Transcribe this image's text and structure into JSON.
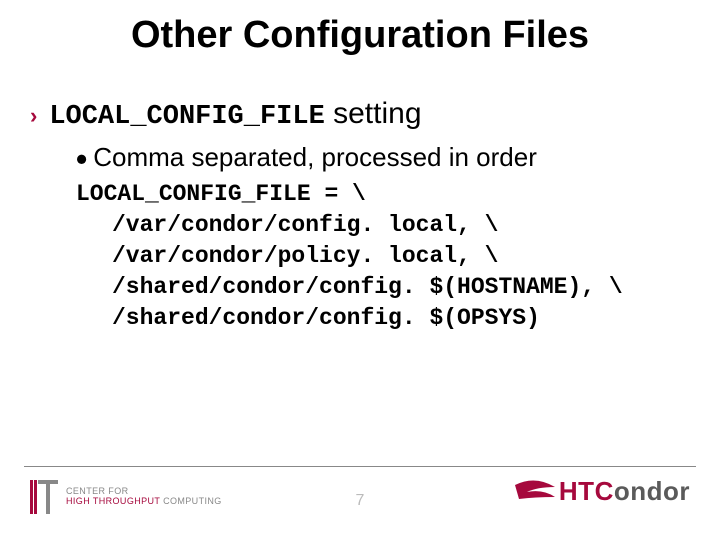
{
  "title": "Other Configuration Files",
  "bullet1": {
    "code": "LOCAL_CONFIG_FILE",
    "tail": " setting"
  },
  "bullet2": "Comma separated, processed in order",
  "code": {
    "l1": "LOCAL_CONFIG_FILE = \\",
    "l2": "/var/condor/config. local, \\",
    "l3": "/var/condor/policy. local, \\",
    "l4": "/shared/condor/config. $(HOSTNAME), \\",
    "l5": "/shared/condor/config. $(OPSYS)"
  },
  "footer": {
    "page": "7",
    "left": {
      "line1": "CENTER FOR",
      "line2a": "HIGH THROUGHPUT",
      "line2b": " COMPUTING"
    },
    "right": {
      "a": "HTC",
      "b": "ondor"
    }
  }
}
